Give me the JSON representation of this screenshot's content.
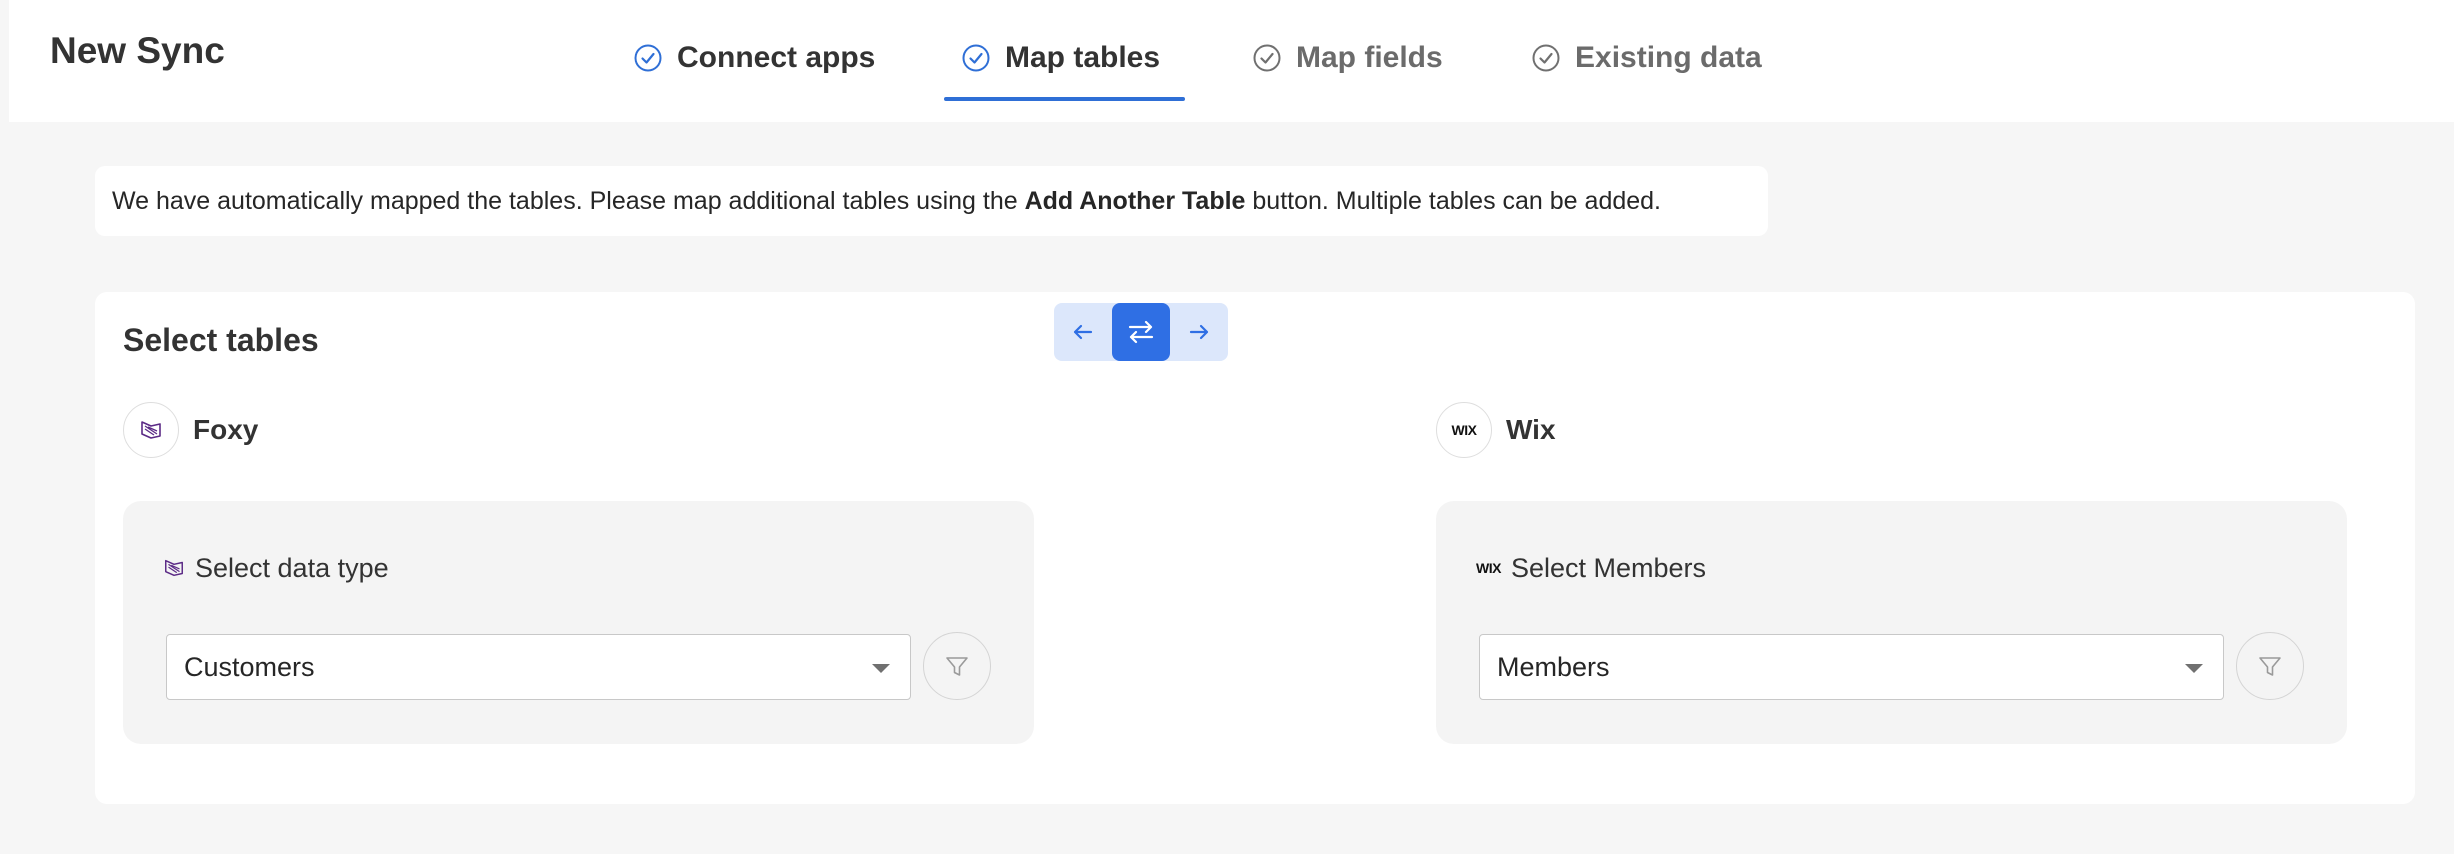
{
  "header": {
    "title": "New Sync",
    "steps": [
      {
        "label": "Connect apps",
        "state": "done"
      },
      {
        "label": "Map tables",
        "state": "active"
      },
      {
        "label": "Map fields",
        "state": "pending"
      },
      {
        "label": "Existing data",
        "state": "pending"
      }
    ]
  },
  "banner": {
    "text_before": "We have automatically mapped the tables. Please map additional tables using the ",
    "bold": "Add Another Table",
    "text_after": " button. Multiple tables can be added."
  },
  "card": {
    "title": "Select tables",
    "source": {
      "app_name": "Foxy",
      "logo_icon": "foxy-logo-icon",
      "panel_label": "Select data type",
      "selected_value": "Customers"
    },
    "destination": {
      "app_name": "Wix",
      "logo_text": "WIX",
      "panel_label": "Select Members",
      "selected_value": "Members"
    },
    "direction": {
      "options": [
        "left-arrow-icon",
        "two-way-arrows-icon",
        "right-arrow-icon"
      ],
      "selected": "two-way-arrows-icon"
    }
  },
  "colors": {
    "accent": "#2f6fe4",
    "toggle_bg": "#dce7fb",
    "foxy_purple": "#5b2a86"
  }
}
